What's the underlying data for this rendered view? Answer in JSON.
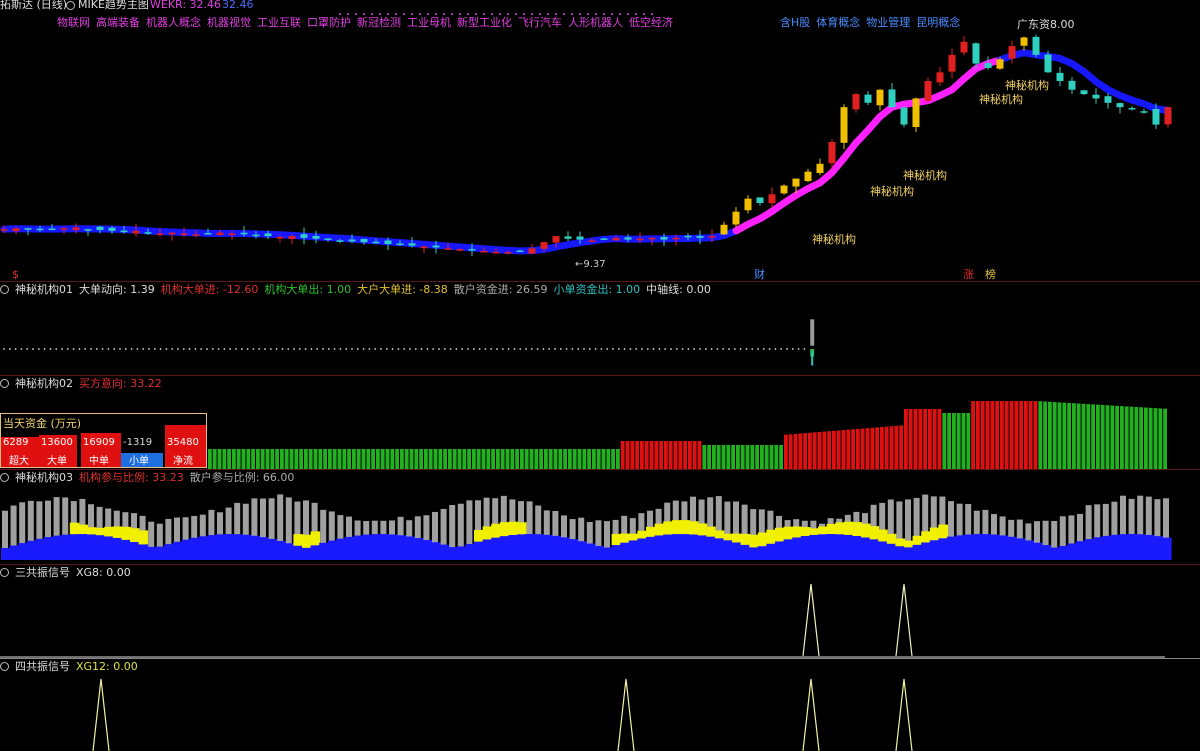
{
  "header": {
    "app": "拓斯达 (日线)",
    "indicator_name": "MIKE趋势主图",
    "indicator_value_label": "WEKR: 32.46",
    "indicator_value2": "32.46",
    "concepts_left": [
      "物联网",
      "高端装备",
      "机器人概念",
      "机器视觉",
      "工业互联",
      "口罩防护",
      "新冠检测",
      "工业母机",
      "新型工业化",
      "飞行汽车",
      "人形机器人",
      "低空经济"
    ],
    "concepts_right": [
      "含H股",
      "体育概念",
      "物业管理",
      "昆明概念"
    ],
    "marker_left": "$",
    "marker_cai": "财",
    "marker_zhang": "涨",
    "marker_bang": "榜",
    "high_label": "广东资8.00",
    "low_label": "←9.37",
    "signal_labels": [
      "神秘机构",
      "神秘机构",
      "神秘机构",
      "神秘机构",
      "神秘机构"
    ]
  },
  "panels": {
    "p1": {
      "title": "神秘机构01",
      "items": [
        {
          "label": "大单动向: 1.39",
          "color": "#dddddd"
        },
        {
          "label": "机构大单进: -12.60",
          "color": "#e03030"
        },
        {
          "label": "机构大单出: 1.00",
          "color": "#30c030"
        },
        {
          "label": "大户大单进: -8.38",
          "color": "#e0c030"
        },
        {
          "label": "散户资金进: 26.59",
          "color": "#aaaaaa"
        },
        {
          "label": "小单资金出: 1.00",
          "color": "#30c0c0"
        },
        {
          "label": "中轴线: 0.00",
          "color": "#dddddd"
        }
      ]
    },
    "p2": {
      "title": "神秘机构02",
      "items": [
        {
          "label": "买方意向: 33.22",
          "color": "#e03030"
        }
      ]
    },
    "p3": {
      "title": "神秘机构03",
      "items": [
        {
          "label": "机构参与比例: 33.23",
          "color": "#e03030"
        },
        {
          "label": "散户参与比例: 66.00",
          "color": "#aaaaaa"
        }
      ]
    },
    "p4": {
      "title": "三共振信号",
      "items": [
        {
          "label": "XG8: 0.00",
          "color": "#dddddd"
        }
      ]
    },
    "p5": {
      "title": "四共振信号",
      "items": [
        {
          "label": "XG12: 0.00",
          "color": "#e0e040"
        }
      ]
    }
  },
  "fundbox": {
    "title": "当天资金 (万元)",
    "items": [
      {
        "value": "6289",
        "label": "超大"
      },
      {
        "value": "13600",
        "label": "大单"
      },
      {
        "value": "16909",
        "label": "中单"
      },
      {
        "value": "-1319",
        "label": "小单"
      },
      {
        "value": "35480",
        "label": "净流"
      }
    ]
  },
  "chart_data": [
    {
      "type": "candlestick",
      "title": "MIKE趋势主图",
      "note": "price series reconstructed approximately; visible labels: low 9.37, high 8.00 marker",
      "close": [
        12.0,
        12.1,
        12.0,
        11.9,
        12.0,
        12.1,
        12.2,
        12.0,
        11.9,
        11.8,
        11.7,
        11.8,
        11.6,
        11.5,
        11.6,
        11.5,
        11.4,
        11.5,
        11.6,
        11.5,
        11.4,
        11.3,
        11.2,
        11.1,
        11.2,
        11.0,
        10.9,
        10.8,
        10.7,
        10.6,
        10.5,
        10.4,
        10.3,
        10.2,
        10.1,
        10.0,
        9.9,
        9.8,
        9.7,
        9.6,
        9.5,
        9.4,
        9.37,
        9.5,
        9.8,
        10.5,
        11.2,
        10.9,
        10.8,
        10.7,
        10.9,
        11.0,
        10.8,
        10.9,
        11.0,
        10.8,
        11.0,
        11.1,
        11.0,
        11.2,
        12.5,
        14.0,
        15.5,
        15.0,
        16.0,
        17.0,
        17.8,
        18.6,
        19.5,
        22.0,
        26.0,
        27.5,
        26.5,
        28.0,
        26.0,
        24.0,
        27.0,
        29.0,
        30.0,
        32.0,
        33.5,
        31.0,
        30.5,
        31.5,
        33.0,
        34.0,
        32.0,
        30.0,
        29.0,
        28.0,
        27.5,
        27.0,
        26.5,
        26.0,
        25.8,
        25.5,
        24.0,
        26.0
      ],
      "ma_line_color_low": "#1010ff",
      "ma_line_color_high": "#ff20ff"
    },
    {
      "type": "bar",
      "title": "神秘机构01",
      "series_names": [
        "大单动向",
        "机构大单进",
        "机构大单出",
        "大户大单进",
        "散户资金进",
        "小单资金出",
        "中轴线"
      ]
    },
    {
      "type": "bar",
      "title": "神秘机构02",
      "series_names": [
        "买方意向"
      ],
      "buy_intent_last": 33.22
    },
    {
      "type": "area",
      "title": "神秘机构03",
      "series_names": [
        "机构参与比例",
        "散户参与比例"
      ],
      "last": [
        33.23,
        66.0
      ]
    },
    {
      "type": "line",
      "title": "三共振信号",
      "series_names": [
        "XG8"
      ],
      "last": 0.0
    },
    {
      "type": "line",
      "title": "四共振信号",
      "series_names": [
        "XG12"
      ],
      "last": 0.0
    }
  ]
}
